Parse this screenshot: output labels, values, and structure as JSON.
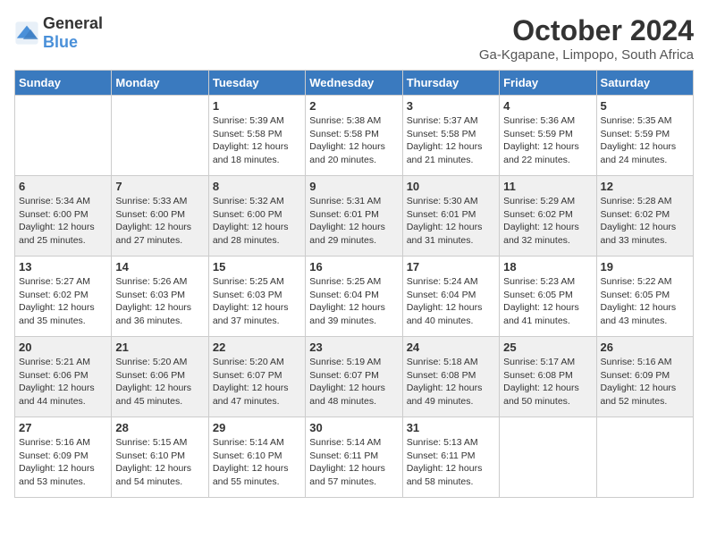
{
  "logo": {
    "general": "General",
    "blue": "Blue"
  },
  "title": "October 2024",
  "location": "Ga-Kgapane, Limpopo, South Africa",
  "days_of_week": [
    "Sunday",
    "Monday",
    "Tuesday",
    "Wednesday",
    "Thursday",
    "Friday",
    "Saturday"
  ],
  "weeks": [
    [
      {
        "day": "",
        "content": ""
      },
      {
        "day": "",
        "content": ""
      },
      {
        "day": "1",
        "content": "Sunrise: 5:39 AM\nSunset: 5:58 PM\nDaylight: 12 hours and 18 minutes."
      },
      {
        "day": "2",
        "content": "Sunrise: 5:38 AM\nSunset: 5:58 PM\nDaylight: 12 hours and 20 minutes."
      },
      {
        "day": "3",
        "content": "Sunrise: 5:37 AM\nSunset: 5:58 PM\nDaylight: 12 hours and 21 minutes."
      },
      {
        "day": "4",
        "content": "Sunrise: 5:36 AM\nSunset: 5:59 PM\nDaylight: 12 hours and 22 minutes."
      },
      {
        "day": "5",
        "content": "Sunrise: 5:35 AM\nSunset: 5:59 PM\nDaylight: 12 hours and 24 minutes."
      }
    ],
    [
      {
        "day": "6",
        "content": "Sunrise: 5:34 AM\nSunset: 6:00 PM\nDaylight: 12 hours and 25 minutes."
      },
      {
        "day": "7",
        "content": "Sunrise: 5:33 AM\nSunset: 6:00 PM\nDaylight: 12 hours and 27 minutes."
      },
      {
        "day": "8",
        "content": "Sunrise: 5:32 AM\nSunset: 6:00 PM\nDaylight: 12 hours and 28 minutes."
      },
      {
        "day": "9",
        "content": "Sunrise: 5:31 AM\nSunset: 6:01 PM\nDaylight: 12 hours and 29 minutes."
      },
      {
        "day": "10",
        "content": "Sunrise: 5:30 AM\nSunset: 6:01 PM\nDaylight: 12 hours and 31 minutes."
      },
      {
        "day": "11",
        "content": "Sunrise: 5:29 AM\nSunset: 6:02 PM\nDaylight: 12 hours and 32 minutes."
      },
      {
        "day": "12",
        "content": "Sunrise: 5:28 AM\nSunset: 6:02 PM\nDaylight: 12 hours and 33 minutes."
      }
    ],
    [
      {
        "day": "13",
        "content": "Sunrise: 5:27 AM\nSunset: 6:02 PM\nDaylight: 12 hours and 35 minutes."
      },
      {
        "day": "14",
        "content": "Sunrise: 5:26 AM\nSunset: 6:03 PM\nDaylight: 12 hours and 36 minutes."
      },
      {
        "day": "15",
        "content": "Sunrise: 5:25 AM\nSunset: 6:03 PM\nDaylight: 12 hours and 37 minutes."
      },
      {
        "day": "16",
        "content": "Sunrise: 5:25 AM\nSunset: 6:04 PM\nDaylight: 12 hours and 39 minutes."
      },
      {
        "day": "17",
        "content": "Sunrise: 5:24 AM\nSunset: 6:04 PM\nDaylight: 12 hours and 40 minutes."
      },
      {
        "day": "18",
        "content": "Sunrise: 5:23 AM\nSunset: 6:05 PM\nDaylight: 12 hours and 41 minutes."
      },
      {
        "day": "19",
        "content": "Sunrise: 5:22 AM\nSunset: 6:05 PM\nDaylight: 12 hours and 43 minutes."
      }
    ],
    [
      {
        "day": "20",
        "content": "Sunrise: 5:21 AM\nSunset: 6:06 PM\nDaylight: 12 hours and 44 minutes."
      },
      {
        "day": "21",
        "content": "Sunrise: 5:20 AM\nSunset: 6:06 PM\nDaylight: 12 hours and 45 minutes."
      },
      {
        "day": "22",
        "content": "Sunrise: 5:20 AM\nSunset: 6:07 PM\nDaylight: 12 hours and 47 minutes."
      },
      {
        "day": "23",
        "content": "Sunrise: 5:19 AM\nSunset: 6:07 PM\nDaylight: 12 hours and 48 minutes."
      },
      {
        "day": "24",
        "content": "Sunrise: 5:18 AM\nSunset: 6:08 PM\nDaylight: 12 hours and 49 minutes."
      },
      {
        "day": "25",
        "content": "Sunrise: 5:17 AM\nSunset: 6:08 PM\nDaylight: 12 hours and 50 minutes."
      },
      {
        "day": "26",
        "content": "Sunrise: 5:16 AM\nSunset: 6:09 PM\nDaylight: 12 hours and 52 minutes."
      }
    ],
    [
      {
        "day": "27",
        "content": "Sunrise: 5:16 AM\nSunset: 6:09 PM\nDaylight: 12 hours and 53 minutes."
      },
      {
        "day": "28",
        "content": "Sunrise: 5:15 AM\nSunset: 6:10 PM\nDaylight: 12 hours and 54 minutes."
      },
      {
        "day": "29",
        "content": "Sunrise: 5:14 AM\nSunset: 6:10 PM\nDaylight: 12 hours and 55 minutes."
      },
      {
        "day": "30",
        "content": "Sunrise: 5:14 AM\nSunset: 6:11 PM\nDaylight: 12 hours and 57 minutes."
      },
      {
        "day": "31",
        "content": "Sunrise: 5:13 AM\nSunset: 6:11 PM\nDaylight: 12 hours and 58 minutes."
      },
      {
        "day": "",
        "content": ""
      },
      {
        "day": "",
        "content": ""
      }
    ]
  ]
}
